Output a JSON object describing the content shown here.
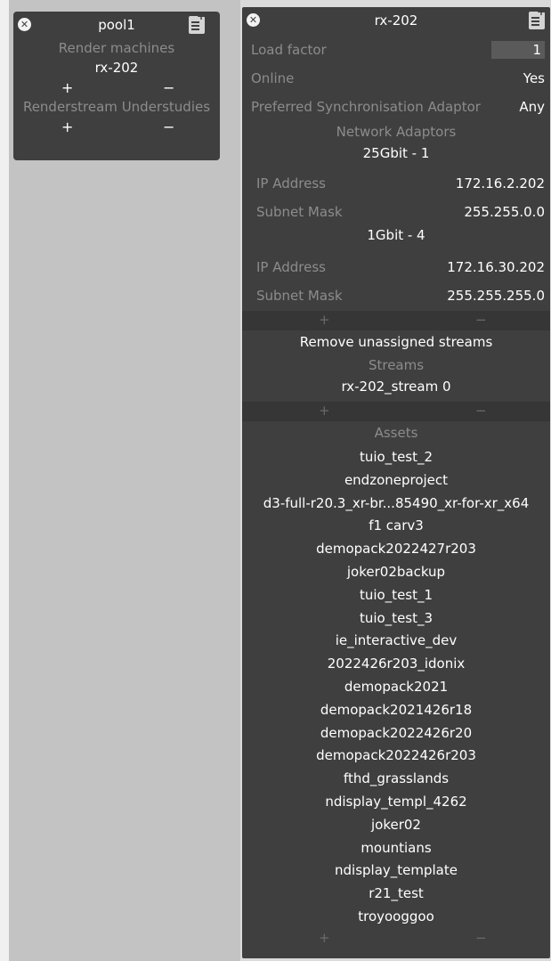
{
  "pool_panel": {
    "title": "pool1",
    "render_machines_label": "Render machines",
    "render_machine_item": "rx-202",
    "understudies_label": "Renderstream Understudies",
    "plus": "+",
    "minus": "−"
  },
  "machine_panel": {
    "title": "rx-202",
    "load_factor_label": "Load factor",
    "load_factor_value": "1",
    "online_label": "Online",
    "online_value": "Yes",
    "sync_adaptor_label": "Preferred Synchronisation Adaptor",
    "sync_adaptor_value": "Any",
    "network_adaptors_label": "Network Adaptors",
    "adaptors": [
      {
        "name": "25Gbit - 1",
        "ip_label": "IP Address",
        "ip": "172.16.2.202",
        "mask_label": "Subnet Mask",
        "mask": "255.255.0.0"
      },
      {
        "name": "1Gbit - 4",
        "ip_label": "IP Address",
        "ip": "172.16.30.202",
        "mask_label": "Subnet Mask",
        "mask": "255.255.255.0"
      }
    ],
    "plus": "+",
    "minus": "−",
    "remove_streams_label": "Remove unassigned streams",
    "streams_label": "Streams",
    "stream_item": "rx-202_stream 0",
    "assets_label": "Assets",
    "assets": [
      "tuio_test_2",
      "endzoneproject",
      "d3-full-r20.3_xr-br...85490_xr-for-xr_x64",
      "f1 carv3",
      "demopack2022427r203",
      "joker02backup",
      "tuio_test_1",
      "tuio_test_3",
      "ie_interactive_dev",
      "2022426r203_idonix",
      "demopack2021",
      "demopack2021426r18",
      "demopack2022426r20",
      "demopack2022426r203",
      "fthd_grasslands",
      "ndisplay_templ_4262",
      "joker02",
      "mountians",
      "ndisplay_template",
      "r21_test",
      "troyooggoo"
    ]
  }
}
